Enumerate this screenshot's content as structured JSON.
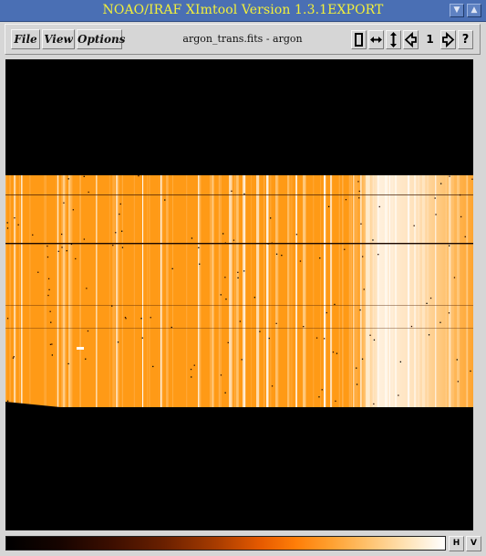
{
  "window": {
    "title": "NOAO/IRAF XImtool Version 1.3.1EXPORT"
  },
  "menus": [
    {
      "label": "File"
    },
    {
      "label": "View"
    },
    {
      "label": "Options"
    }
  ],
  "frame_title": "argon_trans.fits - argon",
  "toolbar": {
    "frame_number": "1",
    "help_label": "?",
    "icons": [
      "fit-frame-icon",
      "flip-x-icon",
      "flip-y-icon",
      "previous-frame-icon",
      "next-frame-icon",
      "help-icon"
    ]
  },
  "colorbar": {
    "colormap": "heat",
    "h_label": "H",
    "v_label": "V"
  },
  "colors": {
    "titlebar": "#4a6fb4",
    "title_text": "#f3f03a",
    "image_orange": "#ff9a16"
  }
}
